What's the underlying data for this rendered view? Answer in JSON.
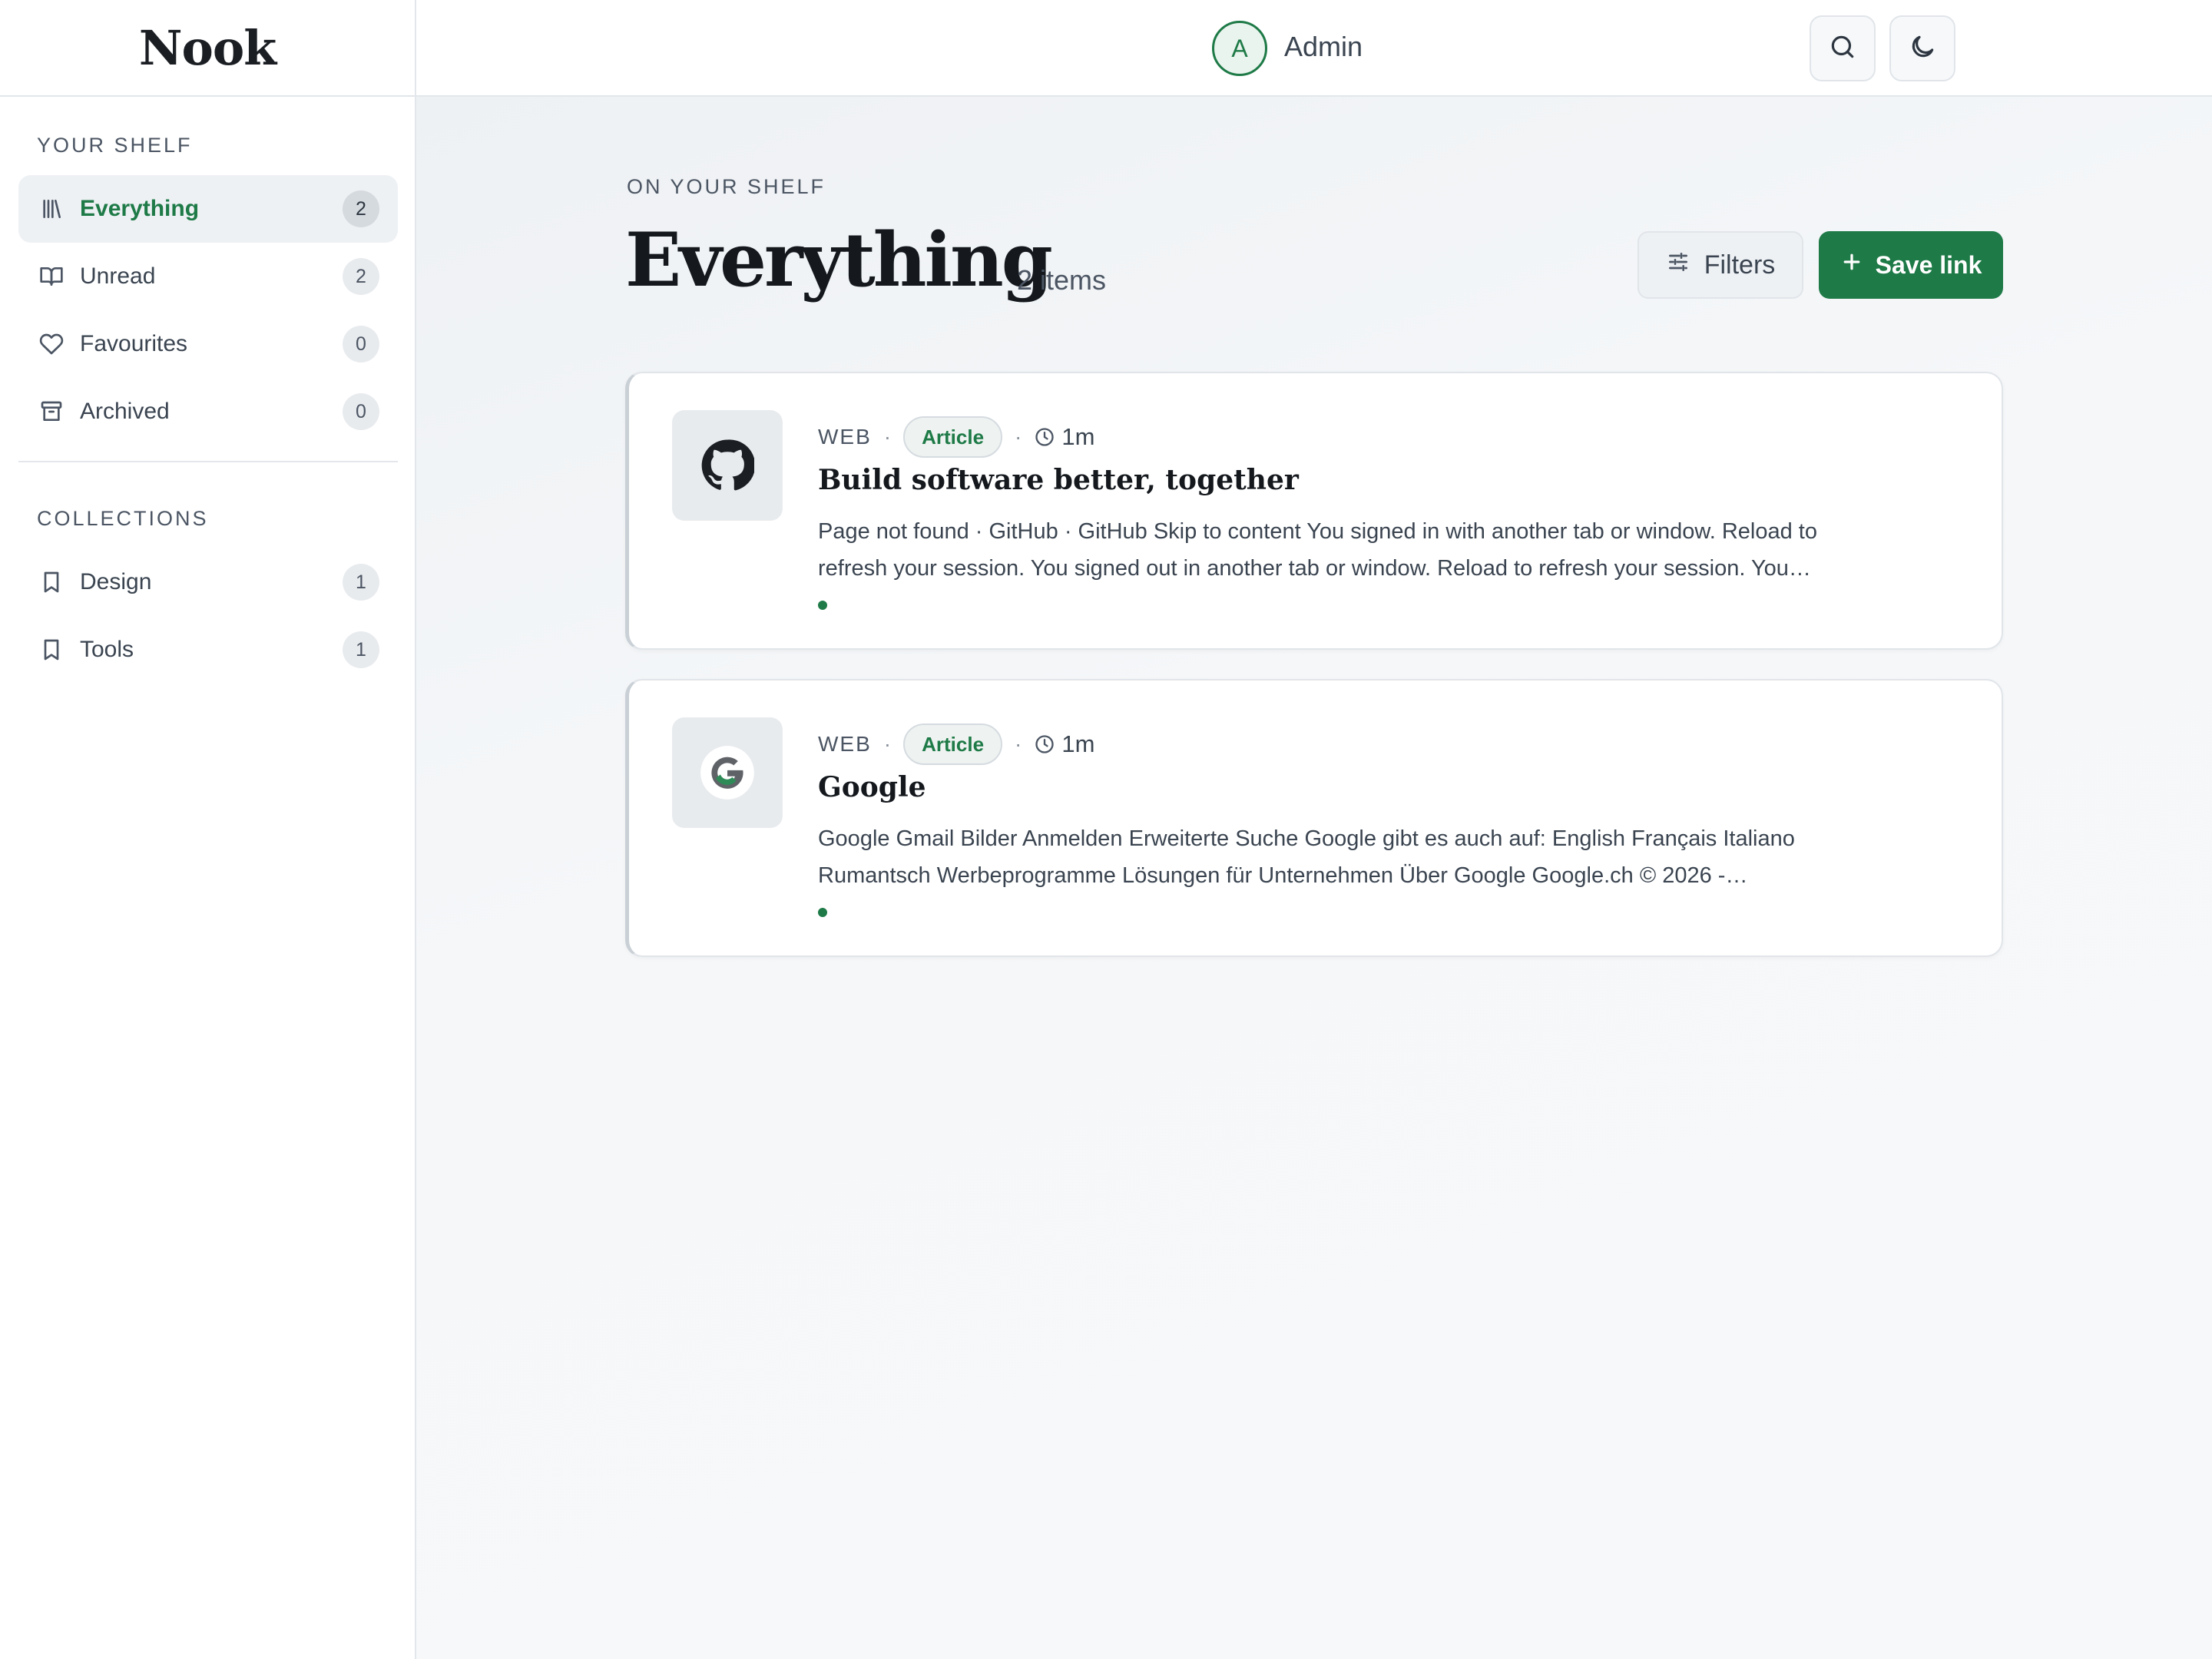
{
  "brand": "Nook",
  "sidebar": {
    "shelf_label": "YOUR SHELF",
    "shelf_items": [
      {
        "label": "Everything",
        "count": "2",
        "icon": "library-icon",
        "active": true
      },
      {
        "label": "Unread",
        "count": "2",
        "icon": "book-open-icon"
      },
      {
        "label": "Favourites",
        "count": "0",
        "icon": "heart-icon"
      },
      {
        "label": "Archived",
        "count": "0",
        "icon": "archive-icon"
      }
    ],
    "collections_label": "COLLECTIONS",
    "collections": [
      {
        "label": "Design",
        "count": "1",
        "icon": "bookmark-icon"
      },
      {
        "label": "Tools",
        "count": "1",
        "icon": "bookmark-icon"
      }
    ]
  },
  "topbar": {
    "search_icon": "search-icon",
    "theme_icon": "moon-icon",
    "avatar_initial": "A",
    "user_name": "Admin"
  },
  "main": {
    "eyebrow": "ON YOUR SHELF",
    "title": "Everything",
    "items_count": "2 items",
    "filters_label": "Filters",
    "save_label": "Save link"
  },
  "cards": [
    {
      "source": "WEB",
      "separator": "·",
      "tag": "Article",
      "time": "1m",
      "title": "Build software better, together",
      "description": "Page not found · GitHub · GitHub Skip to content You signed in with another tab or window. Reload to refresh your session. You signed out in another tab or window. Reload to refresh your session. You…",
      "favicon": "github-icon"
    },
    {
      "source": "WEB",
      "separator": "·",
      "tag": "Article",
      "time": "1m",
      "title": "Google",
      "description": "Google Gmail Bilder Anmelden Erweiterte Suche Google gibt es auch auf: English Français Italiano Rumantsch Werbeprogramme Lösungen für Unternehmen Über Google Google.ch © 2026 -…",
      "favicon": "google-icon"
    }
  ],
  "colors": {
    "accent": "#1e7a47",
    "sidebar_bg": "#ffffff",
    "main_bg": "#f6f8fa"
  }
}
